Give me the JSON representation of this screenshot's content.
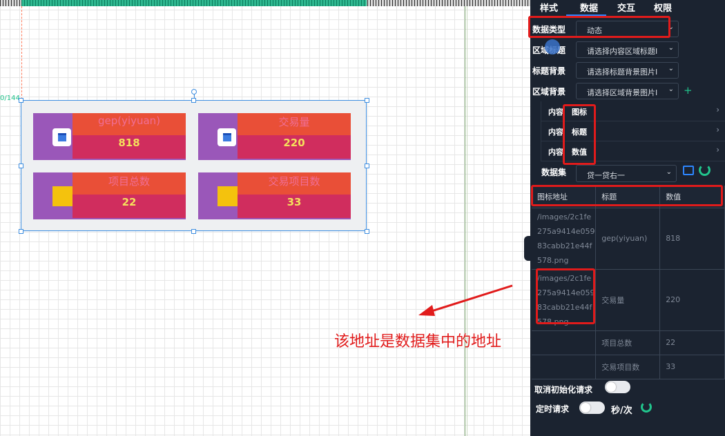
{
  "canvas": {
    "coord_label": "0/144",
    "cards": [
      {
        "title": "gep(yiyuan)",
        "value": "818",
        "icon": "calendar-icon"
      },
      {
        "title": "交易量",
        "value": "220",
        "icon": "calendar-icon"
      },
      {
        "title": "项目总数",
        "value": "22",
        "icon": "yellow-square-icon"
      },
      {
        "title": "交易项目数",
        "value": "33",
        "icon": "yellow-square-icon"
      }
    ]
  },
  "panel": {
    "tabs": [
      "样式",
      "数据",
      "交互",
      "权限"
    ],
    "active_tab": "数据",
    "data_type": {
      "label": "数据类型",
      "value": "动态"
    },
    "region_title": {
      "label": "区域标题",
      "placeholder": "请选择内容区域标题I"
    },
    "title_bg": {
      "label": "标题背景",
      "placeholder": "请选择标题背景图片I"
    },
    "region_bg": {
      "label": "区域背景",
      "placeholder": "请选择区域背景图片I"
    },
    "content_rows": [
      {
        "label": "内容",
        "field": "图标"
      },
      {
        "label": "内容",
        "field": "标题"
      },
      {
        "label": "内容",
        "field": "数值"
      }
    ],
    "dataset": {
      "label": "数据集",
      "value": "贷一贷右一"
    },
    "table": {
      "headers": [
        "图标地址",
        "标题",
        "数值"
      ],
      "rows": [
        [
          "/images/2c1fe275a9414e05983cabb21e44f578.png",
          "gep(yiyuan)",
          "818"
        ],
        [
          "/images/2c1fe275a9414e05983cabb21e44f578.png",
          "交易量",
          "220"
        ],
        [
          "",
          "项目总数",
          "22"
        ],
        [
          "",
          "交易项目数",
          "33"
        ]
      ]
    },
    "cancel_init_label": "取消初始化请求",
    "timed_request_label": "定时请求",
    "per_second_label": "秒/次"
  },
  "annotation": {
    "text": "该地址是数据集中的地址",
    "color": "#e11b1b"
  }
}
